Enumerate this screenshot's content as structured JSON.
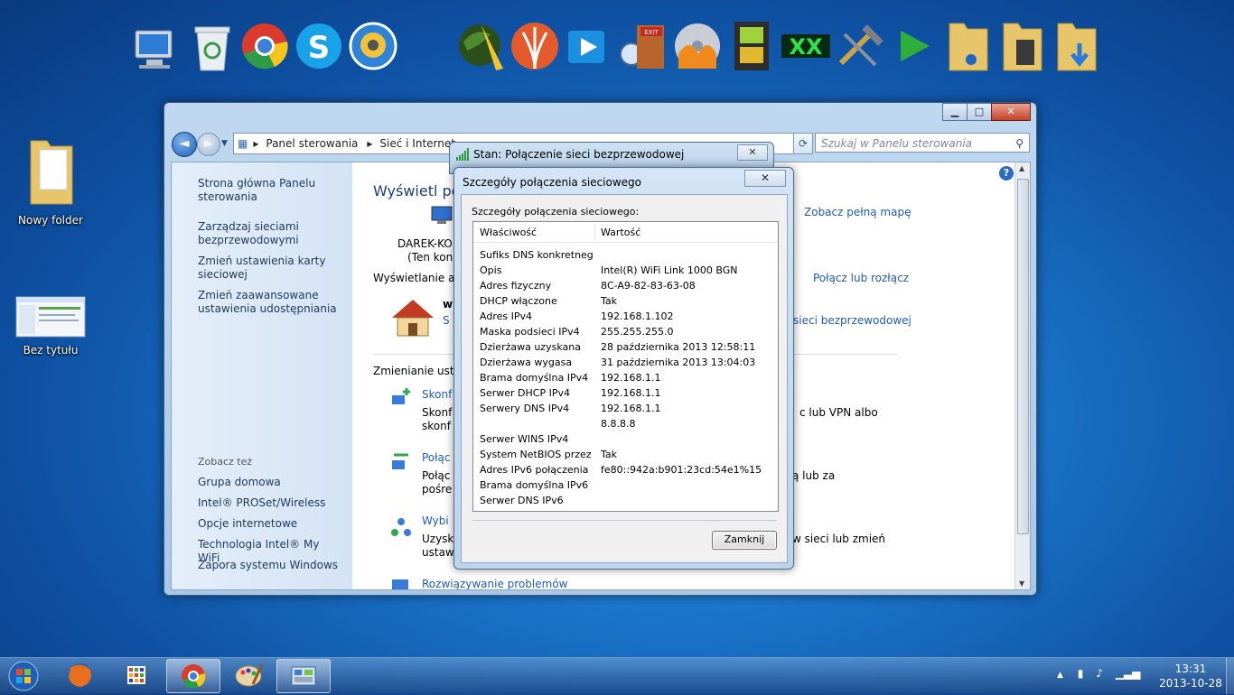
{
  "desktop": {
    "icons": [
      {
        "label": "Nowy folder"
      },
      {
        "label": "Bez tytułu"
      }
    ]
  },
  "dock": [
    "computer-icon",
    "recycle-bin-icon",
    "chrome-icon",
    "skype-icon",
    "webcam-icon",
    "globe-icon",
    "wings-icon",
    "media-player-icon",
    "clock-exit-icon",
    "exit-door-icon",
    "disc-burn-icon",
    "film-icon",
    "xx-icon",
    "tools-icon",
    "play-icon",
    "music-folder-icon",
    "video-folder-icon",
    "downloads-folder-icon"
  ],
  "window": {
    "breadcrumb": {
      "root": "Panel sterowania",
      "level2": "Sieć i Internet"
    },
    "search_placeholder": "Szukaj w Panelu sterowania",
    "left": {
      "links": [
        "Strona główna Panelu sterowania",
        "Zarządzaj sieciami bezprzewodowymi",
        "Zmień ustawienia karty sieciowej",
        "Zmień zaawansowane ustawienia udostępniania"
      ],
      "see_also_head": "Zobacz też",
      "see_also": [
        "Grupa domowa",
        "Intel® PROSet/Wireless",
        "Opcje internetowe",
        "Technologia Intel® My WiFi",
        "Zapora systemu Windows"
      ]
    },
    "main": {
      "heading_partial": "Wyświetl po",
      "full_map": "Zobacz pełną mapę",
      "computer_name": "DAREK-KO",
      "computer_note": "(Ten kon",
      "active_label": "Wyświetlanie ak",
      "connect_link": "Połącz lub rozłącz",
      "net_name_partial": "w",
      "s_partial": "S",
      "wireless_link": "sieci bezprzewodowej",
      "change_label": "Zmienianie usta",
      "task1_link": "Skonf",
      "task1_l1": "Skonf",
      "task1_l2": "skonf",
      "task1_right": "c lub VPN albo",
      "task2_link": "Połąc",
      "task2_l1": "Połąc",
      "task2_l2": "pośre",
      "task2_right": "ą lub za",
      "task3_link": "Wybi",
      "task3_l1": "Uzysk",
      "task3_l2": "ustaw",
      "task3_right": "w sieci lub zmień",
      "troubleshoot": "Rozwiązywanie problemów"
    }
  },
  "status_dialog": {
    "title": "Stan: Połączenie sieci bezprzewodowej"
  },
  "details_dialog": {
    "title": "Szczegóły połączenia sieciowego",
    "group_label": "Szczegóły połączenia sieciowego:",
    "col_property": "Właściwość",
    "col_value": "Wartość",
    "rows": [
      {
        "p": "Sufiks DNS konkretneg...",
        "v": ""
      },
      {
        "p": "Opis",
        "v": "Intel(R) WiFi Link 1000 BGN"
      },
      {
        "p": "Adres fizyczny",
        "v": "8C-A9-82-83-63-08"
      },
      {
        "p": "DHCP włączone",
        "v": "Tak"
      },
      {
        "p": "Adres IPv4",
        "v": "192.168.1.102"
      },
      {
        "p": "Maska podsieci IPv4",
        "v": "255.255.255.0"
      },
      {
        "p": "Dzierżawa uzyskana",
        "v": "28 października 2013 12:58:11"
      },
      {
        "p": "Dzierżawa wygasa",
        "v": "31 października 2013 13:04:03"
      },
      {
        "p": "Brama domyślna IPv4",
        "v": "192.168.1.1"
      },
      {
        "p": "Serwer DHCP IPv4",
        "v": "192.168.1.1"
      },
      {
        "p": "Serwery DNS IPv4",
        "v": "192.168.1.1"
      },
      {
        "p": "",
        "v": "8.8.8.8"
      },
      {
        "p": "Serwer WINS IPv4",
        "v": ""
      },
      {
        "p": "System NetBIOS przez T...",
        "v": "Tak"
      },
      {
        "p": "Adres IPv6 połączenia l...",
        "v": "fe80::942a:b901:23cd:54e1%15"
      },
      {
        "p": "Brama domyślna IPv6",
        "v": ""
      },
      {
        "p": "Serwer DNS IPv6",
        "v": ""
      }
    ],
    "close_button": "Zamknij"
  },
  "taskbar": {
    "time": "13:31",
    "date": "2013-10-28"
  }
}
